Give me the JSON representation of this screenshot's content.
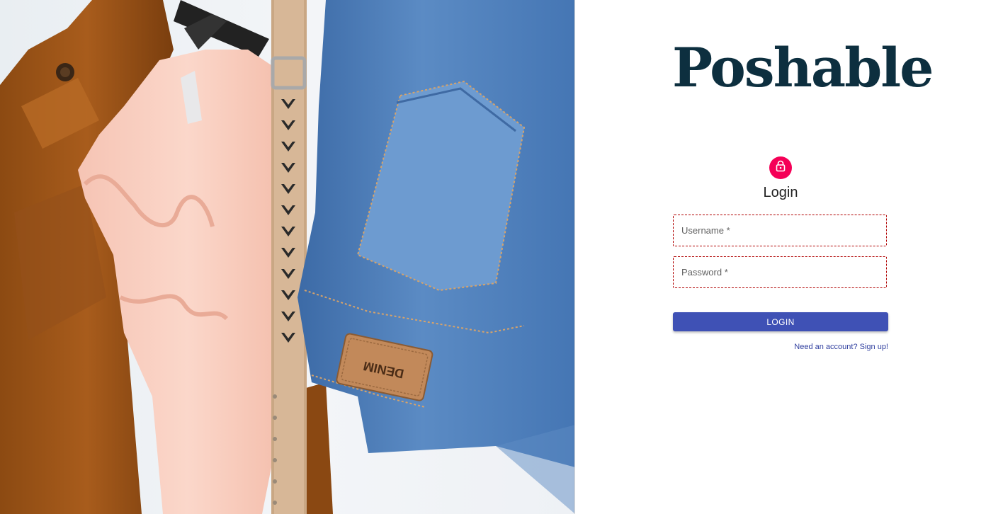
{
  "brand": {
    "name": "Poshable"
  },
  "login": {
    "heading": "Login",
    "username_label": "Username *",
    "password_label": "Password *",
    "submit_label": "LOGIN",
    "signup_link": "Need an account? Sign up!"
  },
  "hero": {
    "patch_text": "DENIM"
  },
  "colors": {
    "brand_text": "#0d2f3f",
    "lock_badge": "#f50057",
    "primary_button": "#3f51b5",
    "link": "#303f9f",
    "field_border_error": "#b00000"
  },
  "icons": {
    "lock": "lock-icon"
  }
}
